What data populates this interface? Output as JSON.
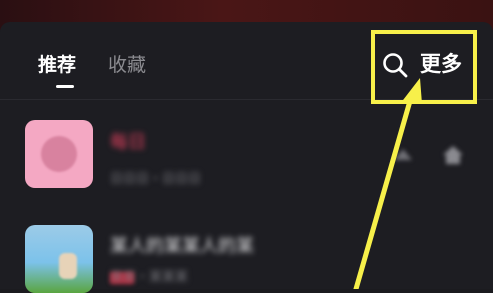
{
  "tabs": [
    {
      "label": "推荐",
      "active": true
    },
    {
      "label": "收藏",
      "active": false
    }
  ],
  "header_actions": {
    "more_label": "更多",
    "search_icon": "search-icon",
    "highlight_color": "#f7f04a"
  },
  "songs": [
    {
      "title": "每日",
      "subtitle": "日日日・日日日",
      "cover_icon": "pink-album-cover"
    },
    {
      "title": "某人的某某人的某",
      "subtitle": "某某・某某某",
      "cover_icon": "sky-album-cover"
    }
  ],
  "colors": {
    "accent": "#e4415f",
    "panel": "#1d1d22",
    "annotation": "#f7f04a"
  }
}
